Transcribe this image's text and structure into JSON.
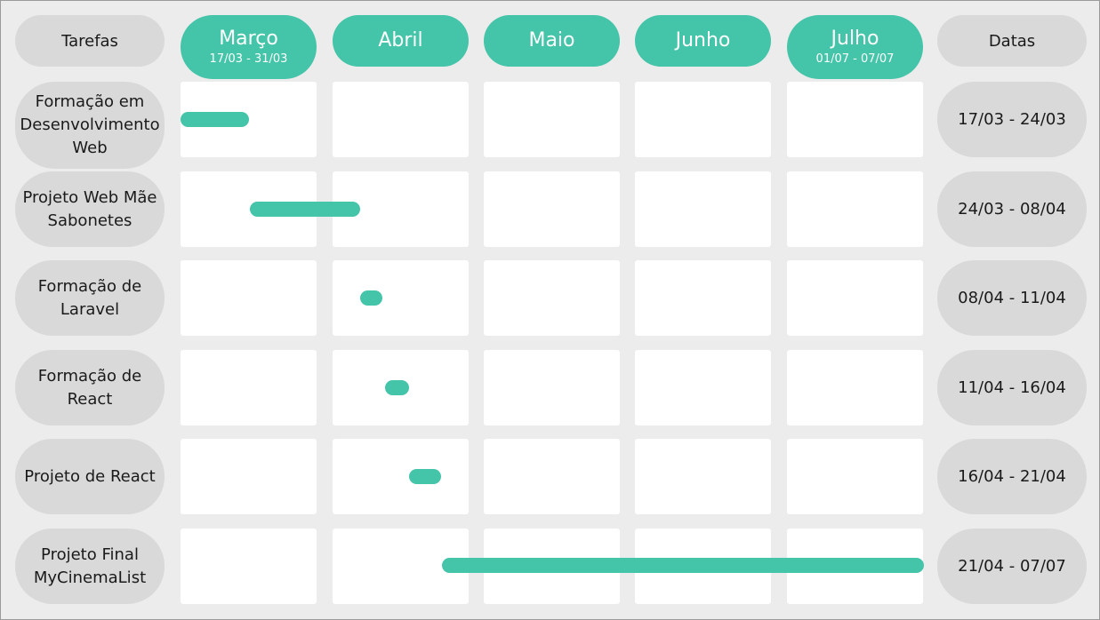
{
  "header": {
    "tasks_label": "Tarefas",
    "dates_label": "Datas"
  },
  "months": [
    {
      "name": "Março",
      "range": "17/03 - 31/03"
    },
    {
      "name": "Abril",
      "range": ""
    },
    {
      "name": "Maio",
      "range": ""
    },
    {
      "name": "Junho",
      "range": ""
    },
    {
      "name": "Julho",
      "range": "01/07 - 07/07"
    }
  ],
  "tasks": [
    {
      "name": "Formação em Desenvolvimento Web",
      "dates": "17/03 - 24/03"
    },
    {
      "name": "Projeto Web Mãe Sabonetes",
      "dates": "24/03 - 08/04"
    },
    {
      "name": "Formação de Laravel",
      "dates": "08/04 - 11/04"
    },
    {
      "name": "Formação de React",
      "dates": "11/04 - 16/04"
    },
    {
      "name": "Projeto de React",
      "dates": "16/04 - 21/04"
    },
    {
      "name": "Projeto Final MyCinemaList",
      "dates": "21/04 - 07/07"
    }
  ],
  "colors": {
    "accent": "#44c4a8",
    "pill_gray": "#d9d9d9",
    "background": "#ececec",
    "cell": "#ffffff"
  }
}
